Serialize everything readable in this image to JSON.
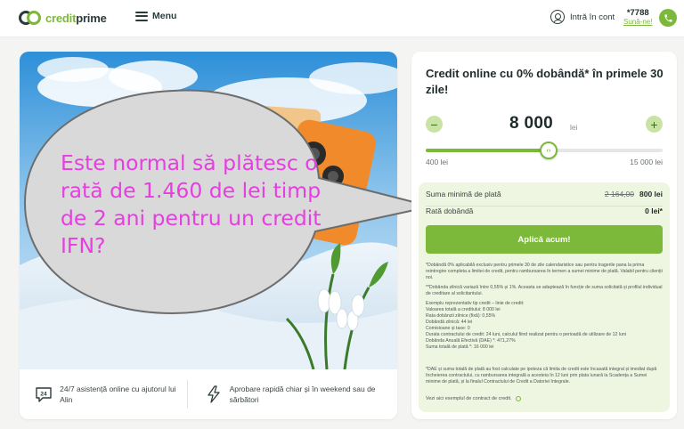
{
  "header": {
    "logo_credit": "credit",
    "logo_prime": "prime",
    "menu_label": "Menu",
    "login_label": "Intră în cont",
    "phone_number": "*7788",
    "phone_call": "Sună-ne!"
  },
  "hero": {
    "bubble_text": "Este normal să plătesc o rată de 1.460 de lei timp de 2 ani pentru un credit IFN?",
    "features": [
      {
        "icon": "24-hour-support-icon",
        "badge": "24",
        "text": "24/7 asistență online cu ajutorul lui Alin"
      },
      {
        "icon": "lightning-icon",
        "text": "Aprobare rapidă chiar și în weekend sau de sărbători"
      }
    ]
  },
  "calculator": {
    "title": "Credit online cu 0% dobândă* în primele 30 zile!",
    "minus": "−",
    "plus": "+",
    "amount": "8 000",
    "amount_unit": "lei",
    "slider_value": 8000,
    "slider_min": 400,
    "slider_max": 15000,
    "range_min_label": "400 lei",
    "range_max_label": "15 000 lei",
    "min_payment_label": "Suma minimă de plată",
    "min_payment_old": "2 164,00",
    "min_payment_value": "800 lei",
    "rate_label": "Rată dobândă",
    "rate_value": "0 lei*",
    "apply_label": "Aplică acum!",
    "fine_print": [
      "*Dobândă 0% aplicabilă exclusiv pentru primele 30 de zile calendaristice sau pentru tragerile pana la prima reintregire completa a limitei de credit, pentru rambursarea în termen a sumei minime de plată. Valabil pentru clienții noi.",
      "**Dobânda zilnică variază între 0,55% și 1%. Aceasta se adaptează în funcție de suma solicitată și profilul individual de creditare al solicitantului.",
      "Exemplu reprezentativ tip credit – linie de credit:\nValoarea totală a creditului: 8 000 lei\nRata dobânzii zilnice (fixă): 0,55%\nDobândă zilnică: 44 lei\nComisioane și taxe: 0\nDurata contractului de credit: 24 luni, calculul fiind realizat pentru o perioadă de utilizare de 12 luni\nDobânda Anuală Efectivă (DAE) *: 471,27%\nSuma totală de plată *: 16 000 lei",
      "*DAE și suma totală de plată au fost calculate pe ipoteza că limita de credit este încasată integral și imediat după încheierea contractului, cu rambursarea integrală a acesteia în 12 luni prin plata lunară la Scadența a Sumei minime de plată, și la finalul Contractului de Credit a Datoriei Integrale."
    ],
    "contract_link": "Vezi aici exemplul de contract de credit."
  },
  "colors": {
    "brand_green": "#7cb83a",
    "light_green": "#eef5e0",
    "bubble_text": "#e63ee0"
  }
}
